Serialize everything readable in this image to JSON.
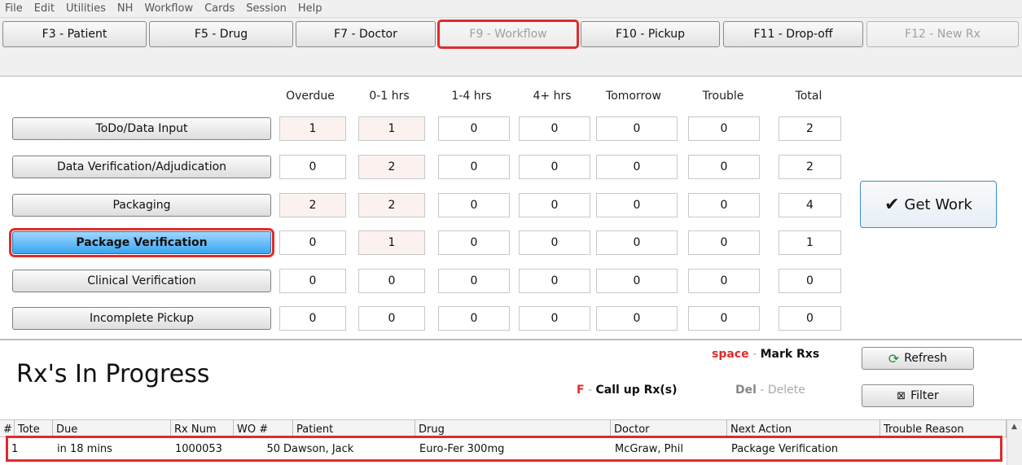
{
  "menu": [
    "File",
    "Edit",
    "Utilities",
    "NH",
    "Workflow",
    "Cards",
    "Session",
    "Help"
  ],
  "fkeys": [
    {
      "label": "F3 - Patient"
    },
    {
      "label": "F5 - Drug"
    },
    {
      "label": "F7 - Doctor"
    },
    {
      "label": "F9 - Workflow"
    },
    {
      "label": "F10 - Pickup"
    },
    {
      "label": "F11 - Drop-off"
    },
    {
      "label": "F12 - New Rx"
    }
  ],
  "columns": [
    "Overdue",
    "0-1 hrs",
    "1-4 hrs",
    "4+ hrs",
    "Tomorrow",
    "Trouble",
    "Total"
  ],
  "queues": [
    {
      "label": "ToDo/Data Input",
      "values": [
        "1",
        "1",
        "0",
        "0",
        "0",
        "0",
        "2"
      ]
    },
    {
      "label": "Data Verification/Adjudication",
      "values": [
        "0",
        "2",
        "0",
        "0",
        "0",
        "0",
        "2"
      ]
    },
    {
      "label": "Packaging",
      "values": [
        "2",
        "2",
        "0",
        "0",
        "0",
        "0",
        "4"
      ]
    },
    {
      "label": "Package Verification",
      "values": [
        "0",
        "1",
        "0",
        "0",
        "0",
        "0",
        "1"
      ]
    },
    {
      "label": "Clinical Verification",
      "values": [
        "0",
        "0",
        "0",
        "0",
        "0",
        "0",
        "0"
      ]
    },
    {
      "label": "Incomplete Pickup",
      "values": [
        "0",
        "0",
        "0",
        "0",
        "0",
        "0",
        "0"
      ]
    }
  ],
  "get_work": {
    "label": "Get Work",
    "icon": "checkmark-icon"
  },
  "in_progress": {
    "title": "Rx's In Progress",
    "hint_space_key": "space",
    "hint_space_sep": " - ",
    "hint_space_label": "Mark Rxs",
    "hint_f_key": "F",
    "hint_f_sep": " - ",
    "hint_f_label": "Call up Rx(s)",
    "hint_del_key": "Del",
    "hint_del_sep": " - ",
    "hint_del_label": "Delete",
    "refresh_label": "Refresh",
    "filter_label": "Filter"
  },
  "table": {
    "headers": [
      "#",
      "Tote",
      "Due",
      "Rx Num",
      "WO #",
      "Patient",
      "Drug",
      "Doctor",
      "Next Action",
      "Trouble Reason"
    ],
    "rows": [
      {
        "num": "1",
        "tote": "",
        "due": "in 18 mins",
        "rx_num": "1000053",
        "wo": "50",
        "patient": "Dawson, Jack",
        "drug": "Euro-Fer 300mg",
        "doctor": "McGraw, Phil",
        "next_action": "Package Verification",
        "trouble": ""
      }
    ]
  },
  "colors": {
    "highlight": "#e02b2b",
    "active_button": "#3aa6f0",
    "overdue_tint": "#fbf2f0"
  }
}
